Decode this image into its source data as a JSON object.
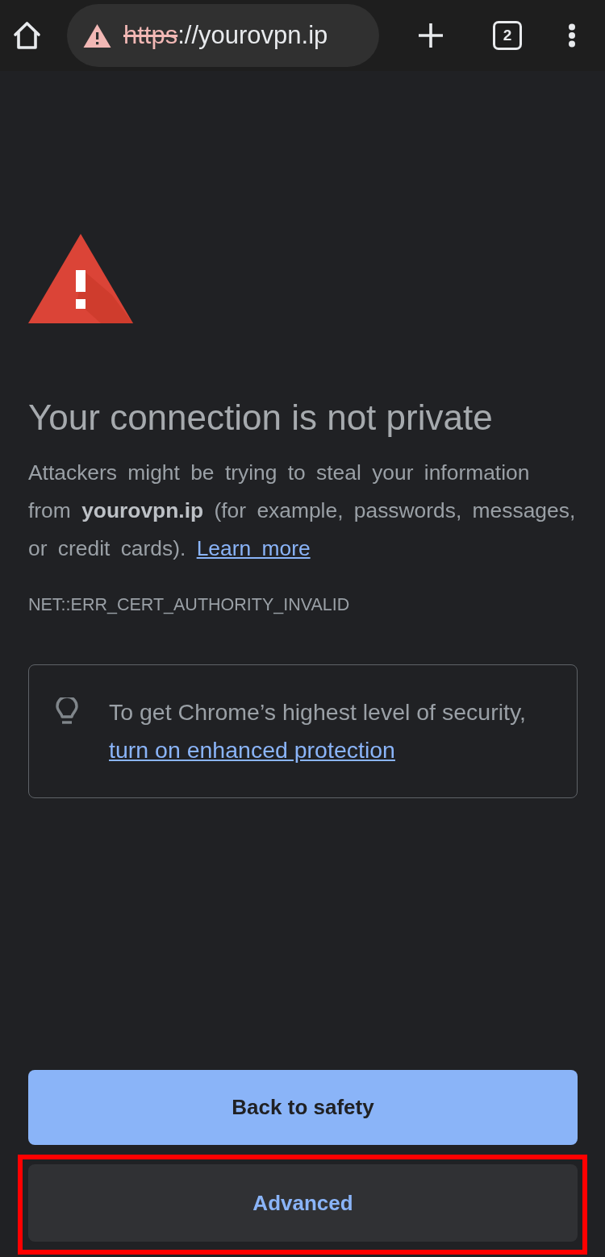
{
  "toolbar": {
    "address": {
      "secure": false,
      "scheme": "https",
      "rest": "://yourovpn.ip"
    },
    "tab_count": "2"
  },
  "interstitial": {
    "title": "Your connection is not private",
    "message": "Attackers might be trying to steal your information from **yourovpn.ip** (for example, passwords, messages, or credit cards).",
    "learn_more_link": "Learn more",
    "error_code": "NET::ERR_CERT_AUTHORITY_INVALID"
  },
  "tip": {
    "text": "To get Chrome’s highest level of security,",
    "link": "turn on enhanced protection"
  },
  "buttons": [
    {
      "label": "Back to safety",
      "kind": "primary",
      "highlighted": false
    },
    {
      "label": "Advanced",
      "kind": "secondary",
      "highlighted": true
    }
  ]
}
